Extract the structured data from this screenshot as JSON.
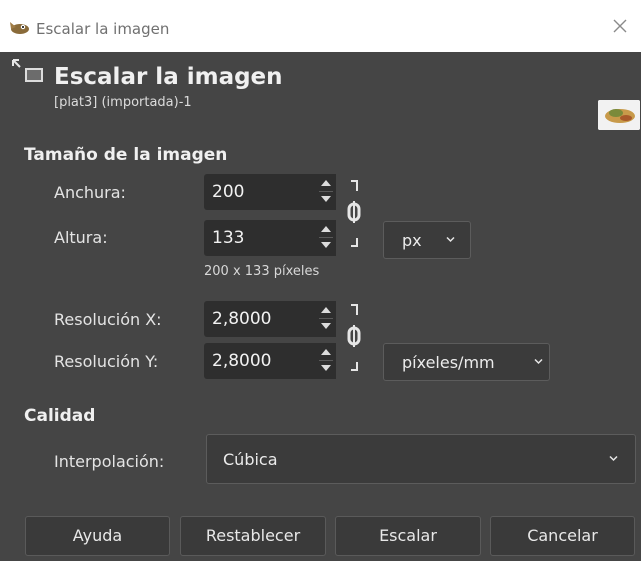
{
  "window": {
    "title": "Escalar la imagen"
  },
  "header": {
    "title": "Escalar la imagen",
    "subtitle": "[plat3] (importada)-1"
  },
  "image_size": {
    "section_label": "Tamaño de la imagen",
    "width_label": "Anchura:",
    "width_value": "200",
    "height_label": "Altura:",
    "height_value": "133",
    "unit": "px",
    "pixels_info": "200 x 133 píxeles",
    "res_x_label": "Resolución X:",
    "res_x_value": "2,8000",
    "res_y_label": "Resolución Y:",
    "res_y_value": "2,8000",
    "res_unit": "píxeles/mm"
  },
  "quality": {
    "section_label": "Calidad",
    "interp_label": "Interpolación:",
    "interp_value": "Cúbica"
  },
  "buttons": {
    "help": "Ayuda",
    "reset": "Restablecer",
    "scale": "Escalar",
    "cancel": "Cancelar"
  }
}
